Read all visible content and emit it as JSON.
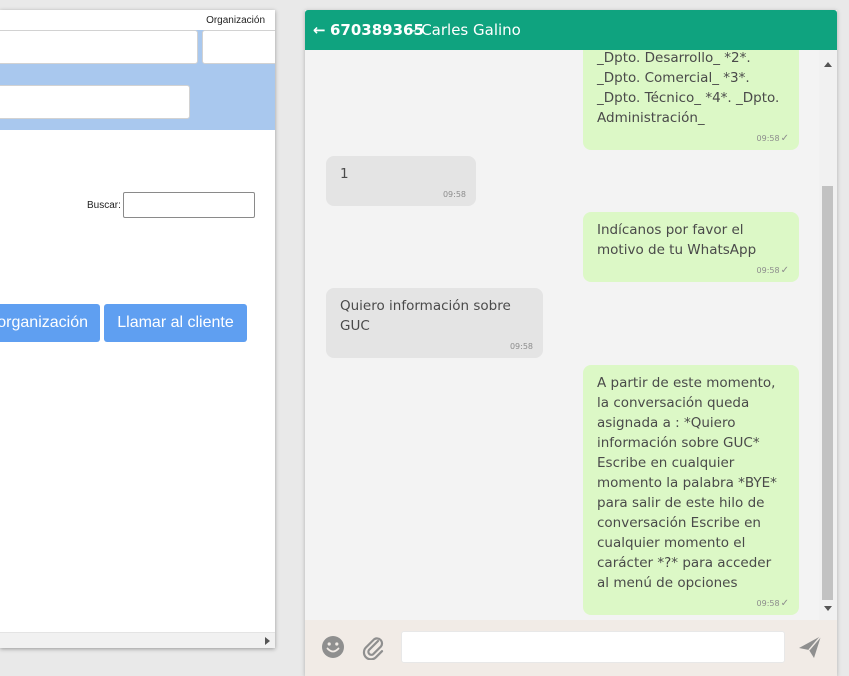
{
  "left_panel": {
    "org_label": "Organización",
    "search_label": "Buscar:",
    "buttons": {
      "org": "organización",
      "call": "Llamar al cliente"
    }
  },
  "chat": {
    "header": {
      "back_icon": "arrow-left-icon",
      "number": "670389365",
      "separator": " - ",
      "name": "Carles Galino"
    },
    "messages": [
      {
        "dir": "out",
        "text": "_Dpto. Desarrollo_ *2*. _Dpto. Comercial_ *3*. _Dpto. Técnico_ *4*. _Dpto. Administración_",
        "time": "09:58"
      },
      {
        "dir": "in",
        "text": "1",
        "time": "09:58"
      },
      {
        "dir": "out",
        "text": "Indícanos por favor el motivo de tu WhatsApp",
        "time": "09:58"
      },
      {
        "dir": "in",
        "text": "Quiero información sobre GUC",
        "time": "09:58"
      },
      {
        "dir": "out",
        "text": "A partir de este momento, la conversación queda asignada a : *Quiero información sobre GUC* Escribe en cualquier momento la palabra *BYE* para salir de este hilo de conversación Escribe en cualquier momento el carácter *?* para acceder al menú de opciones",
        "time": "09:58"
      }
    ],
    "footer": {
      "emoji_icon": "emoji-icon",
      "attach_icon": "paperclip-icon",
      "send_icon": "send-icon",
      "input_value": ""
    }
  },
  "colors": {
    "header_green": "#0fa37f",
    "outgoing_bubble": "#dcf8c6",
    "incoming_bubble": "#e4e4e4",
    "button_blue": "#5f9ff1",
    "form_band_blue": "#a9c8ee"
  }
}
